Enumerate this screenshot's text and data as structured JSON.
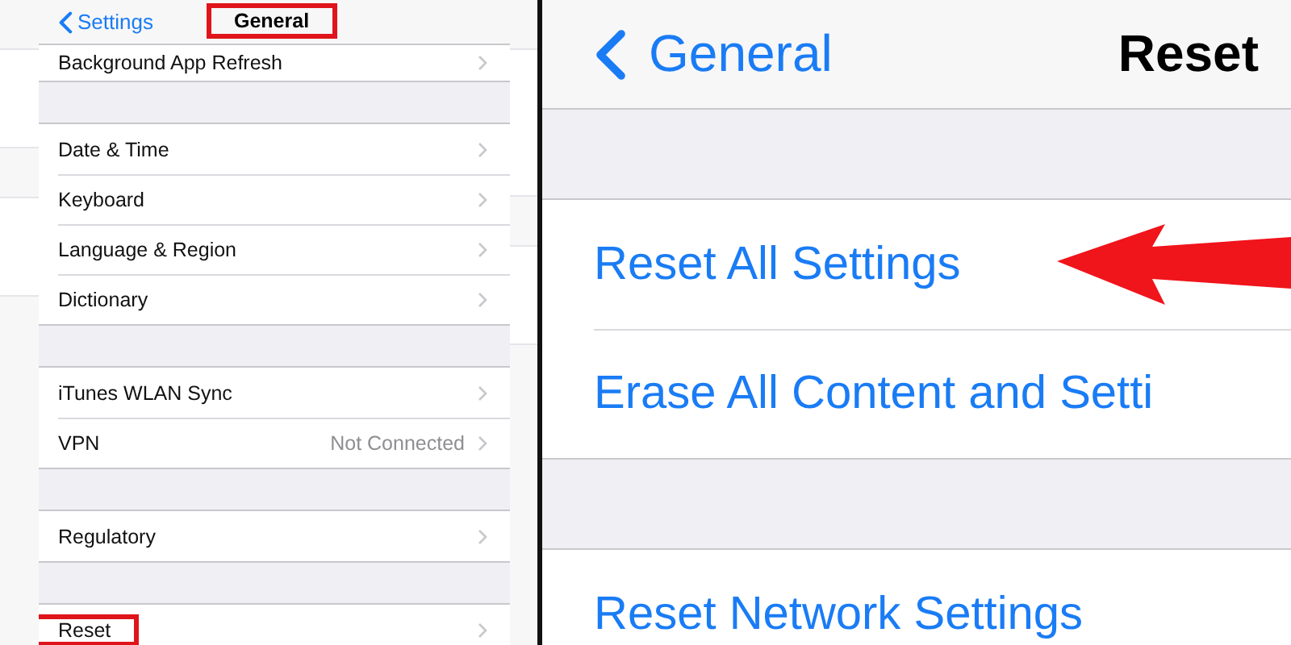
{
  "left_screen": {
    "back_label": "Settings",
    "title": "General",
    "title_highlighted": true,
    "groups": [
      {
        "items": [
          {
            "label": "Background App Refresh",
            "highlighted": false
          }
        ]
      },
      {
        "items": [
          {
            "label": "Date & Time",
            "highlighted": false
          },
          {
            "label": "Keyboard",
            "highlighted": false
          },
          {
            "label": "Language & Region",
            "highlighted": false
          },
          {
            "label": "Dictionary",
            "highlighted": false
          }
        ]
      },
      {
        "items": [
          {
            "label": "iTunes WLAN Sync",
            "highlighted": false
          },
          {
            "label": "VPN",
            "detail": "Not Connected",
            "highlighted": false
          }
        ]
      },
      {
        "items": [
          {
            "label": "Regulatory",
            "highlighted": false
          }
        ]
      },
      {
        "items": [
          {
            "label": "Reset",
            "highlighted": true
          }
        ]
      }
    ]
  },
  "right_screen": {
    "back_label": "General",
    "title": "Reset",
    "groups": [
      {
        "items": [
          {
            "label": "Reset All Settings",
            "arrow": true
          },
          {
            "label": "Erase All Content and Setti",
            "arrow": false
          }
        ]
      },
      {
        "items": [
          {
            "label": "Reset Network Settings",
            "arrow": false
          }
        ]
      }
    ]
  }
}
